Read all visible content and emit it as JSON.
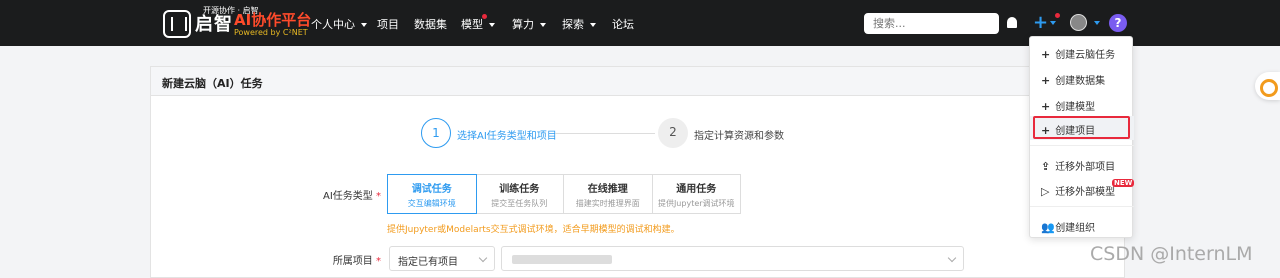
{
  "header": {
    "logo_text": "启智",
    "logo_tagline": "开源协作 · 启智",
    "platform_name": "AI协作平台",
    "powered_by": "Powered by C²NET",
    "nav": [
      {
        "label": "个人中心",
        "dropdown": true
      },
      {
        "label": "项目",
        "dropdown": false
      },
      {
        "label": "数据集",
        "dropdown": false
      },
      {
        "label": "模型",
        "dropdown": true
      },
      {
        "label": "算力",
        "dropdown": true
      },
      {
        "label": "探索",
        "dropdown": true
      },
      {
        "label": "论坛",
        "dropdown": false
      }
    ],
    "search_placeholder": "搜索...",
    "help_label": "?"
  },
  "panel": {
    "title": "新建云脑（AI）任务",
    "steps": [
      {
        "number": "1",
        "label": "选择AI任务类型和项目"
      },
      {
        "number": "2",
        "label": "指定计算资源和参数"
      }
    ],
    "task_type_label": "AI任务类型",
    "task_types": [
      {
        "title": "调试任务",
        "sub": "交互编辑环境"
      },
      {
        "title": "训练任务",
        "sub": "提交至任务队列"
      },
      {
        "title": "在线推理",
        "sub": "描建实时推理界面"
      },
      {
        "title": "通用任务",
        "sub": "提供Jupyter调试环境"
      }
    ],
    "hint": "提供Jupyter或Modelarts交互式调试环境，适合早期模型的调试和构建。",
    "project_label": "所属项目",
    "project_select": "指定已有项目"
  },
  "dropdown_menu": {
    "items": [
      {
        "icon": "+",
        "label": "创建云脑任务"
      },
      {
        "icon": "+",
        "label": "创建数据集"
      },
      {
        "icon": "+",
        "label": "创建模型"
      },
      {
        "icon": "+",
        "label": "创建项目"
      },
      {
        "icon": "⇪",
        "label": "迁移外部项目"
      },
      {
        "icon": "▷",
        "label": "迁移外部模型"
      },
      {
        "icon": "👥",
        "label": "创建组织"
      }
    ],
    "new_badge": "NEW"
  },
  "watermark": "CSDN @InternLM",
  "colors": {
    "accent": "#2e9bf0",
    "danger": "#e8293c",
    "warning": "#f29b1d",
    "topbar": "#1b1c1d"
  }
}
